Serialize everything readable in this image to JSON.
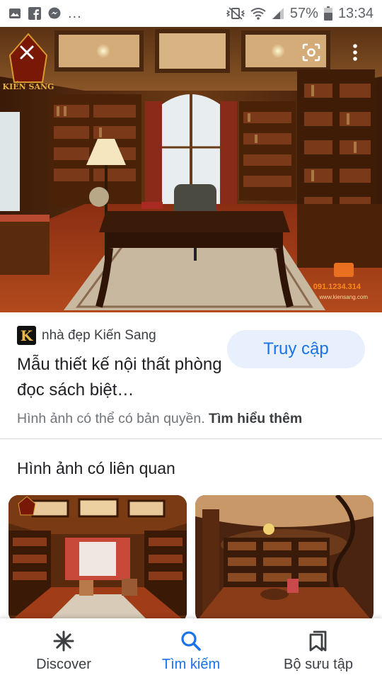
{
  "status_bar": {
    "overflow": "...",
    "battery": "57%",
    "time": "13:34",
    "left_icons": [
      "gallery-icon",
      "facebook-icon",
      "messenger-icon"
    ],
    "right_icons": [
      "vibrate-icon",
      "wifi-icon",
      "signal-icon",
      "battery-icon"
    ]
  },
  "hero": {
    "description_icons": [
      "close-icon",
      "lens-icon",
      "more-vert-icon"
    ],
    "watermark_brand": "KIẾN SANG",
    "watermark_phone": "091.1234.314",
    "watermark_site": "www.kiensang.com"
  },
  "result": {
    "favicon_letter": "K",
    "source": "nhà đẹp Kiến Sang",
    "title": "Mẫu thiết kế nội thất phòng đọc sách biệt…",
    "visit_label": "Truy cập",
    "copyright_text": "Hình ảnh có thể có bản quyền.",
    "learn_more": "Tìm hiểu thêm"
  },
  "related": {
    "heading": "Hình ảnh có liên quan"
  },
  "bottom_nav": {
    "items": [
      {
        "label": "Discover",
        "icon": "asterisk-icon",
        "active": false
      },
      {
        "label": "Tìm kiếm",
        "icon": "search-icon",
        "active": true
      },
      {
        "label": "Bộ sưu tập",
        "icon": "bookmark-collection-icon",
        "active": false
      }
    ]
  },
  "colors": {
    "accent": "#1a73e8",
    "visit_bg": "#e8f0fe",
    "secondary_text": "#70757a"
  }
}
